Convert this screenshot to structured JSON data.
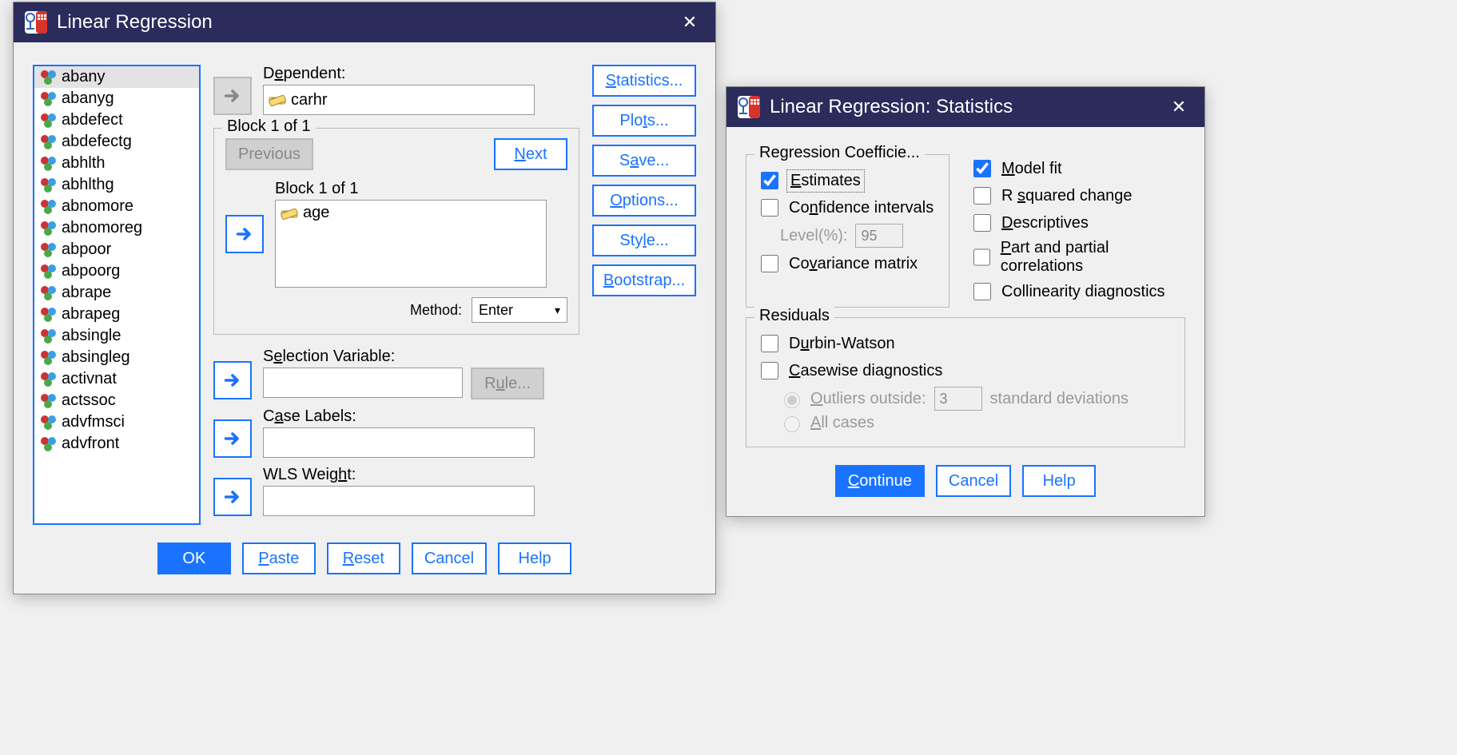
{
  "main_dialog": {
    "title": "Linear Regression",
    "close_icon": "close-icon",
    "varlist": [
      "abany",
      "abanyg",
      "abdefect",
      "abdefectg",
      "abhlth",
      "abhlthg",
      "abnomore",
      "abnomoreg",
      "abpoor",
      "abpoorg",
      "abrape",
      "abrapeg",
      "absingle",
      "absingleg",
      "activnat",
      "actssoc",
      "advfmsci",
      "advfront"
    ],
    "selected_var_index": 0,
    "dependent": {
      "label_pre": "D",
      "label_hot": "e",
      "label_post": "pendent:",
      "value": "carhr"
    },
    "block": {
      "legend": "Block 1 of 1",
      "prev_label": "Previous",
      "next_pre": "",
      "next_hot": "N",
      "next_post": "ext",
      "label": "Block 1 of 1",
      "items": [
        "age"
      ],
      "method_pre": "M",
      "method_hot": "e",
      "method_post": "thod:",
      "method_value": "Enter"
    },
    "sel_var": {
      "label_pre": "S",
      "label_hot": "e",
      "label_post": "lection Variable:",
      "rule_pre": "R",
      "rule_hot": "u",
      "rule_post": "le..."
    },
    "case_labels": {
      "label_pre": "C",
      "label_hot": "a",
      "label_post": "se Labels:"
    },
    "wls": {
      "label_pre": "WLS Weig",
      "label_hot": "h",
      "label_post": "t:"
    },
    "right_buttons": {
      "stats_pre": "",
      "stats_hot": "S",
      "stats_post": "tatistics...",
      "plots_pre": "Plo",
      "plots_hot": "t",
      "plots_post": "s...",
      "save_pre": "S",
      "save_hot": "a",
      "save_post": "ve...",
      "options_pre": "",
      "options_hot": "O",
      "options_post": "ptions...",
      "style_pre": "Sty",
      "style_hot": "l",
      "style_post": "e...",
      "boot_pre": "",
      "boot_hot": "B",
      "boot_post": "ootstrap..."
    },
    "bottom_buttons": {
      "ok": "OK",
      "paste_pre": "",
      "paste_hot": "P",
      "paste_post": "aste",
      "reset_pre": "",
      "reset_hot": "R",
      "reset_post": "eset",
      "cancel": "Cancel",
      "help": "Help"
    }
  },
  "stats_dialog": {
    "title": "Linear Regression: Statistics",
    "left_group_legend": "Regression Coefficie...",
    "estimates_hot": "E",
    "estimates_post": "stimates",
    "ci_pre": "Co",
    "ci_hot": "n",
    "ci_post": "fidence intervals",
    "level_label": "Level(%):",
    "level_value": "95",
    "cov_pre": "Co",
    "cov_hot": "v",
    "cov_post": "ariance matrix",
    "modelfit_hot": "M",
    "modelfit_post": "odel fit",
    "r2_pre": "R ",
    "r2_hot": "s",
    "r2_post": "quared change",
    "desc_hot": "D",
    "desc_post": "escriptives",
    "ppc_hot": "P",
    "ppc_post": "art and partial correlations",
    "collin_pre": "Collinearity diagnostics",
    "residuals_legend": "Residuals",
    "durbin_pre": "D",
    "durbin_hot": "u",
    "durbin_post": "rbin-Watson",
    "casewise_hot": "C",
    "casewise_post": "asewise diagnostics",
    "outliers_pre": "",
    "outliers_hot": "O",
    "outliers_post": "utliers outside:",
    "outliers_value": "3",
    "stddev_label": "standard deviations",
    "allcases_hot": "A",
    "allcases_post": "ll cases",
    "buttons": {
      "continue_hot": "C",
      "continue_post": "ontinue",
      "cancel": "Cancel",
      "help": "Help"
    }
  }
}
